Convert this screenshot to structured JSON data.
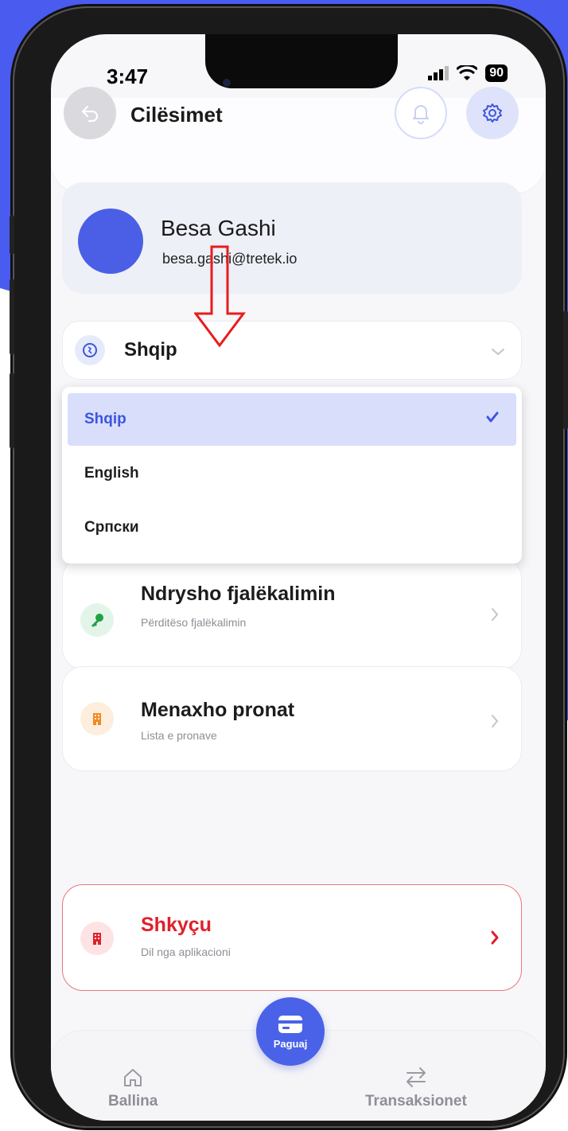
{
  "status_bar": {
    "time": "3:47",
    "battery": "90"
  },
  "header": {
    "title": "Cilësimet"
  },
  "profile": {
    "name": "Besa Gashi",
    "email": "besa.gashi@tretek.io"
  },
  "language_select": {
    "value": "Shqip",
    "options": [
      {
        "label": "Shqip",
        "selected": true
      },
      {
        "label": "English",
        "selected": false
      },
      {
        "label": "Српски",
        "selected": false
      }
    ]
  },
  "menu": [
    {
      "title": "Ndrysho fjalëkalimin",
      "subtitle": "Përditëso fjalëkalimin",
      "icon": "key-icon",
      "color": "#22a046"
    },
    {
      "title": "Menaxho pronat",
      "subtitle": "Lista e pronave",
      "icon": "building-icon",
      "color": "#f08a24"
    }
  ],
  "logout": {
    "title": "Shkyçu",
    "subtitle": "Dil nga aplikacioni",
    "color": "#e0202a"
  },
  "tabbar": {
    "home": "Ballina",
    "pay": "Paguaj",
    "transactions": "Transaksionet"
  },
  "colors": {
    "accent": "#4a5fe6",
    "danger": "#e0202a",
    "annotation": "#e81c1c"
  }
}
